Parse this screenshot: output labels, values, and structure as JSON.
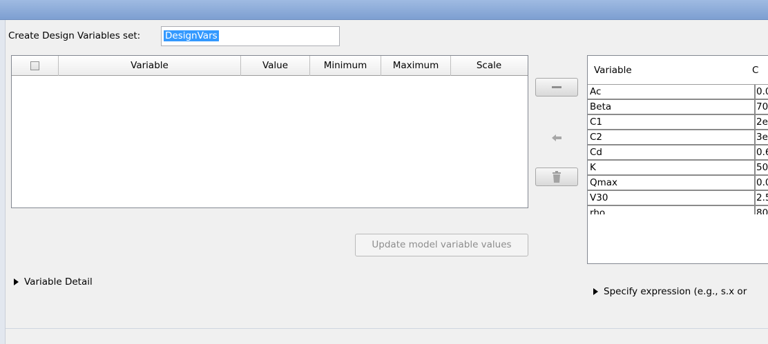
{
  "form": {
    "set_label": "Create Design Variables set:",
    "set_name_value": "DesignVars"
  },
  "design_table": {
    "columns": [
      "Variable",
      "Value",
      "Minimum",
      "Maximum",
      "Scale"
    ],
    "rows": []
  },
  "buttons": {
    "update_label": "Update model variable values"
  },
  "workspace_table": {
    "columns": [
      "Variable",
      "C"
    ],
    "rows": [
      {
        "variable": "Ac",
        "value": "0.0"
      },
      {
        "variable": "Beta",
        "value": "70"
      },
      {
        "variable": "C1",
        "value": "2e"
      },
      {
        "variable": "C2",
        "value": "3e"
      },
      {
        "variable": "Cd",
        "value": "0.6"
      },
      {
        "variable": "K",
        "value": "50"
      },
      {
        "variable": "Qmax",
        "value": "0.0"
      },
      {
        "variable": "V30",
        "value": "2.5"
      },
      {
        "variable": "rho",
        "value": "80"
      }
    ]
  },
  "sections": {
    "variable_detail": "Variable Detail",
    "specify_expression": "Specify expression (e.g., s.x or"
  },
  "icons": {
    "remove": "minus-icon",
    "move_left": "arrow-left-icon",
    "delete": "trash-icon"
  },
  "colors": {
    "titlebar": "#8aa9d8",
    "selection": "#3399ff"
  }
}
